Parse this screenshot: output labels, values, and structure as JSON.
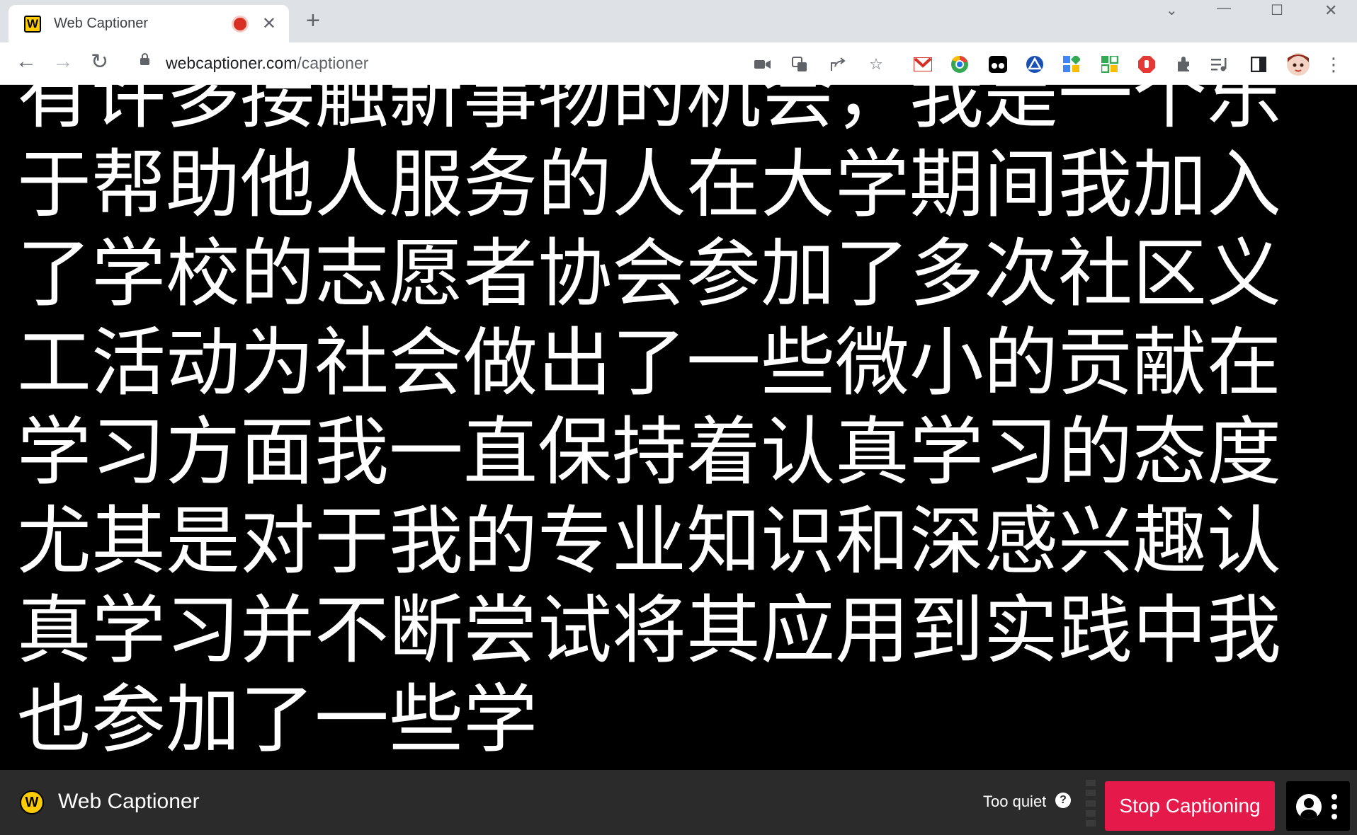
{
  "browser": {
    "tab_title": "Web Captioner",
    "favicon_letter": "W",
    "new_tab_symbol": "+",
    "url_host": "webcaptioner.com",
    "url_path": "/captioner",
    "extension_icons": [
      "camera-icon",
      "translate-icon",
      "share-icon",
      "star-icon",
      "gmail-icon",
      "chrome-icon",
      "incognito-icon",
      "triangle-ext-icon",
      "grid-ext-icon",
      "apps-ext-icon",
      "stop-ext-icon",
      "extensions-icon",
      "media-icon",
      "sidepanel-icon",
      "profile-avatar",
      "menu-icon"
    ]
  },
  "caption": {
    "text": "有许多接触新事物的机会，我是一个乐于帮助他人服务的人在大学期间我加入了学校的志愿者协会参加了多次社区义工活动为社会做出了一些微小的贡献在学习方面我一直保持着认真学习的态度尤其是对于我的专业知识和深感兴趣认真学习并不断尝试将其应用到实践中我也参加了一些学"
  },
  "bottombar": {
    "logo_letter": "W",
    "brand": "Web Captioner",
    "status": "Too quiet",
    "help_symbol": "?",
    "stop_label": "Stop Captioning"
  },
  "colors": {
    "accent": "#e5194a",
    "brand_yellow": "#ffcc00",
    "bar_bg": "#2b2b2b"
  }
}
